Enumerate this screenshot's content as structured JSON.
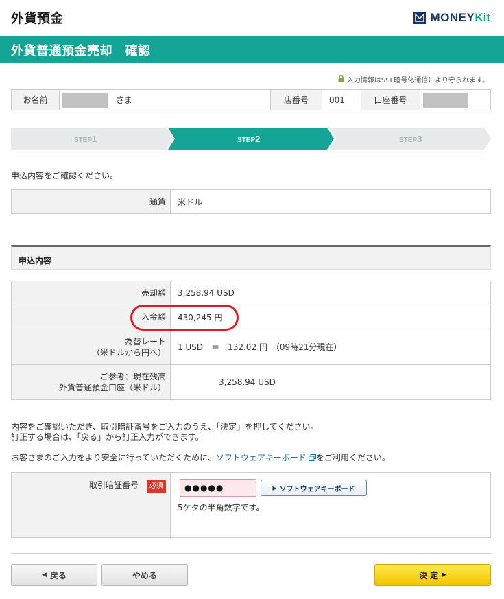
{
  "header": {
    "title": "外貨預金",
    "logo_money": "MONEY",
    "logo_kit": "Kit"
  },
  "banner": {
    "title": "外貨普通預金売却　確認"
  },
  "ssl_notice": "入力情報はSSL暗号化通信により守られます。",
  "customer": {
    "name_label": "お名前",
    "name_suffix": "さま",
    "branch_label": "店番号",
    "branch_value": "001",
    "account_label": "口座番号"
  },
  "steps": [
    {
      "prefix": "STEP",
      "num": "1"
    },
    {
      "prefix": "STEP",
      "num": "2"
    },
    {
      "prefix": "STEP",
      "num": "3"
    }
  ],
  "intro": "申込内容をご確認ください。",
  "currency": {
    "label": "通貨",
    "value": "米ドル"
  },
  "section_title": "申込内容",
  "details": {
    "sell_label": "売却額",
    "sell_value": "3,258.94 USD",
    "deposit_label": "入金額",
    "deposit_value": "430,245 円",
    "rate_label_1": "為替レート",
    "rate_label_2": "（米ドルから円へ）",
    "rate_value": "1 USD　＝　132.02 円　（09時21分現在）",
    "ref_label_1": "ご参考：現在残高",
    "ref_label_2": "外貨普通預金口座（米ドル）",
    "ref_value": "3,258.94 USD"
  },
  "instructions": {
    "line1": "内容をご確認いただき、取引暗証番号をご入力のうえ、「決定」を押してください。",
    "line2": "訂正する場合は、「戻る」から訂正入力ができます。",
    "safety_prefix": "お客さまのご入力をより安全に行っていただくために、",
    "safety_link": "ソフトウェアキーボード",
    "safety_suffix": "をご利用ください。"
  },
  "pin": {
    "label": "取引暗証番号",
    "required": "必須",
    "value": "●●●●●",
    "keyboard_button": "ソフトウェアキーボード",
    "hint": "5ケタの半角数字です。"
  },
  "buttons": {
    "back": "戻る",
    "cancel": "やめる",
    "decide": "決 定"
  },
  "colors": {
    "brand_teal": "#14a596",
    "brand_navy": "#17355e",
    "highlight_red": "#e01b24",
    "decide_yellow": "#f5c400"
  }
}
